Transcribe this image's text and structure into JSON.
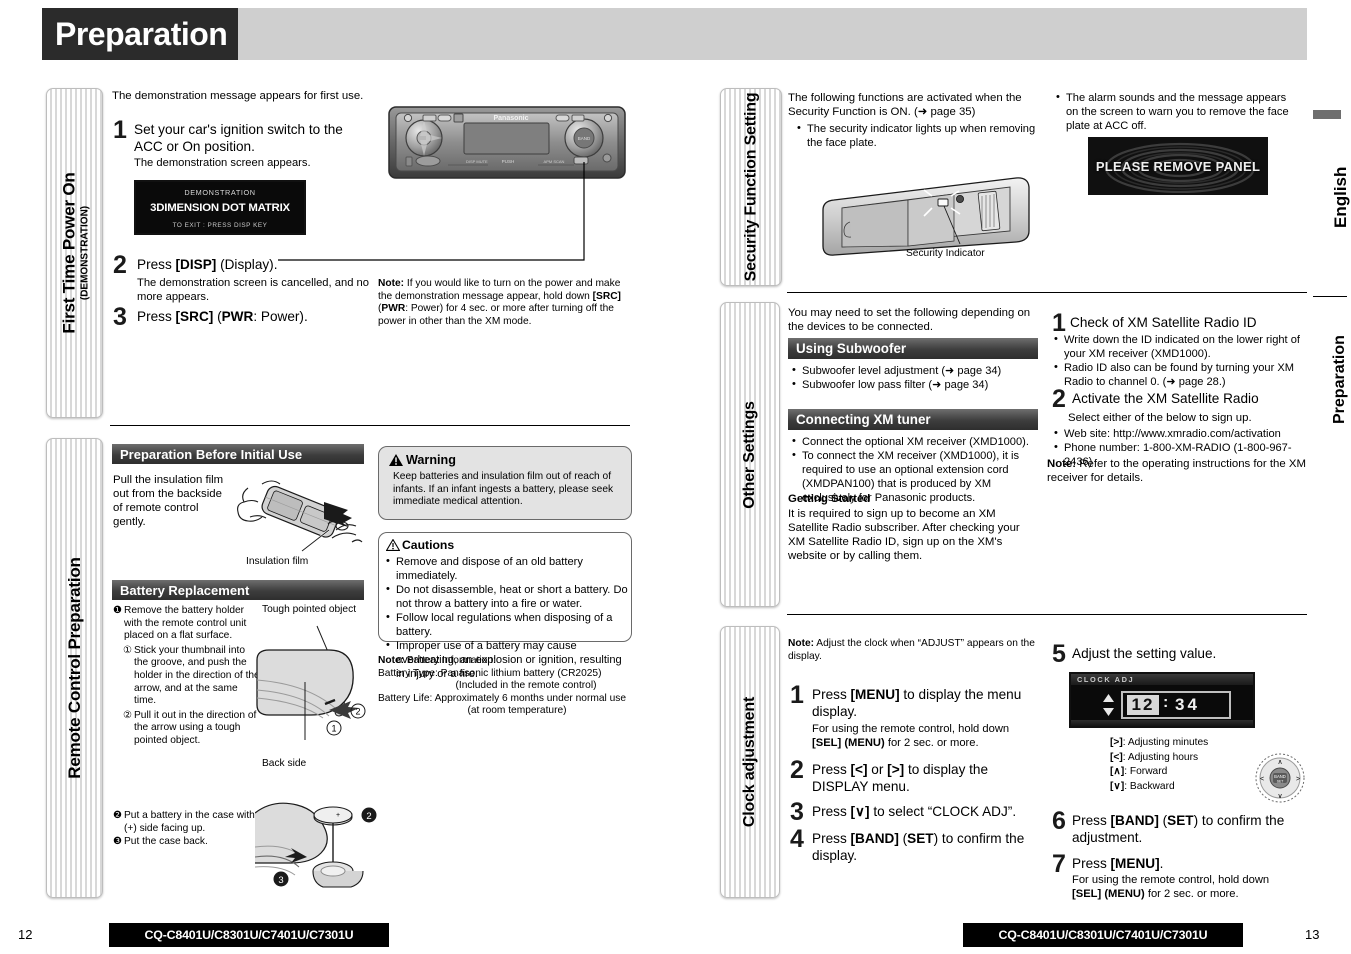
{
  "header": {
    "title": "Preparation"
  },
  "edge_tabs": {
    "english": "English",
    "preparation": "Preparation"
  },
  "left_page": {
    "page_number": "12",
    "footer_models": "CQ-C8401U/C8301U/C7401U/C7301U",
    "section_first_time": {
      "tab_label": "First Time Power On",
      "tab_sub": "(DEMONSTRATION)",
      "intro": "The demonstration message appears for first use.",
      "steps": [
        {
          "num": "1",
          "text": "Set your car's ignition switch to the ACC or On position.",
          "sub": "The demonstration screen appears."
        },
        {
          "num": "2",
          "text_parts": [
            "Press ",
            "[DISP]",
            " (Display)."
          ],
          "sub": "The demonstration screen is cancelled, and no more appears."
        },
        {
          "num": "3",
          "text_parts": [
            "Press ",
            "[SRC]",
            " (",
            "PWR",
            ": Power)."
          ]
        }
      ],
      "demo_screen": {
        "line1": "DEMONSTRATION",
        "line2": "3DIMENSION DOT MATRIX",
        "line3": "TO EXIT : PRESS DISP KEY"
      },
      "unit_brand": "Panasonic",
      "note": "Note: If you would like to turn on the power and make the demonstration message appear, hold down [SRC] (PWR: Power) for 4 sec. or more after turning off the power in other than the XM mode."
    },
    "section_remote": {
      "tab_label": "Remote Control Preparation",
      "bar_initial_use": "Preparation Before Initial Use",
      "initial_use_text": "Pull the insulation film out from the backside of remote control gently.",
      "insulation_caption": "Insulation film",
      "bar_battery": "Battery Replacement",
      "battery_step1_head": "Remove the battery holder with the remote control unit placed on a flat surface.",
      "battery_sub1": "Stick your thumbnail into the groove, and push the holder in the direction of the arrow, and at the same time.",
      "battery_sub2": "Pull it out in the direction of the arrow using a tough pointed object.",
      "battery_step2": "Put a battery in the case with (+) side facing up.",
      "battery_step3": "Put the case back.",
      "caption_tough": "Tough pointed object",
      "caption_backside": "Back side",
      "warning": {
        "title": "Warning",
        "text": "Keep batteries and insulation film out of reach of infants. If an infant ingests a battery, please seek immediate medical attention."
      },
      "cautions": {
        "title": "Cautions",
        "items": [
          "Remove and dispose of an old battery immediately.",
          "Do not disassemble, heat or short a battery. Do not throw a battery into a fire or water.",
          "Follow local regulations when disposing of a battery.",
          "Improper use of a battery may cause overheating, an explosion or ignition, resulting in injury or a fire."
        ]
      },
      "battery_note": {
        "head": "Note: Battery Information:",
        "line1": "Battery Type: Panasonic lithium battery (CR2025)",
        "line2": "(Included in the remote control)",
        "line3": "Battery Life: Approximately 6 months under normal use",
        "line4": "(at room temperature)"
      }
    }
  },
  "right_page": {
    "page_number": "13",
    "footer_models": "CQ-C8401U/C8301U/C7401U/C7301U",
    "section_security": {
      "tab_label": "Security Function Setting",
      "intro": "The following functions are activated when the Security Function is ON. (➜ page 35)",
      "bullet1": "The security indicator lights up when removing the face plate.",
      "indicator_caption": "Security Indicator",
      "bullet2": "The alarm sounds and the message appears on the screen to warn you to remove the face plate at ACC off.",
      "alarm_screen_text": "PLEASE REMOVE PANEL"
    },
    "section_other": {
      "tab_label": "Other Settings",
      "intro": "You may need to set the following depending on the devices to be connected.",
      "bar_subwoofer": "Using Subwoofer",
      "subwoofer_items": [
        "Subwoofer level adjustment (➜ page 34)",
        "Subwoofer low pass filter (➜ page 34)"
      ],
      "bar_xm": "Connecting XM tuner",
      "xm_items": [
        "Connect the optional XM receiver (XMD1000).",
        "To connect the XM receiver (XMD1000), it is required to use an optional extension cord (XMDPAN100) that is produced by XM exclusively for Panasonic products."
      ],
      "getting_started_head": "Getting Started",
      "getting_started_text": "It is required to sign up to become an XM Satellite Radio subscriber. After checking your XM Satellite Radio ID, sign up on the XM's website or by calling them.",
      "step1_title": "Check of XM Satellite Radio ID",
      "step1_items": [
        "Write down the ID indicated on the lower right of your XM receiver (XMD1000).",
        "Radio ID also can be found by turning your XM Radio to channel 0. (➜ page 28.)"
      ],
      "step2_title": "Activate the XM Satellite Radio",
      "step2_sub": "Select either of the below to sign up.",
      "step2_items": [
        "Web site: http://www.xmradio.com/activation",
        "Phone number: 1-800-XM-RADIO (1-800-967-2436)"
      ],
      "note": "Note: Refer to the operating instructions for the XM receiver for details."
    },
    "section_clock": {
      "tab_label": "Clock adjustment",
      "note": "Note: Adjust the clock when “ADJUST” appears on the display.",
      "steps": [
        {
          "num": "1",
          "text": "Press [MENU] to display the menu display.",
          "sub": "For using the remote control, hold down [SEL] (MENU) for 2 sec. or more."
        },
        {
          "num": "2",
          "text": "Press [<] or [>] to display the DISPLAY menu."
        },
        {
          "num": "3",
          "text": "Press [∨] to select “CLOCK ADJ”."
        },
        {
          "num": "4",
          "text": "Press [BAND] (SET) to confirm the display."
        },
        {
          "num": "5",
          "text": "Adjust the setting value."
        },
        {
          "num": "6",
          "text": "Press [BAND] (SET) to confirm the adjustment."
        },
        {
          "num": "7",
          "text": "Press [MENU].",
          "sub": "For using the remote control, hold down [SEL] (MENU) for 2 sec. or more."
        }
      ],
      "clock_screen": {
        "label": "CLOCK ADJ",
        "hours": "12",
        "sep": ":",
        "minutes": "34"
      },
      "key_legend": [
        {
          "key": "[>]",
          "desc": ": Adjusting minutes"
        },
        {
          "key": "[<]",
          "desc": ": Adjusting hours"
        },
        {
          "key": "[∧]",
          "desc": ": Forward"
        },
        {
          "key": "[∨]",
          "desc": ": Backward"
        }
      ],
      "dial_label": "BAND"
    }
  }
}
